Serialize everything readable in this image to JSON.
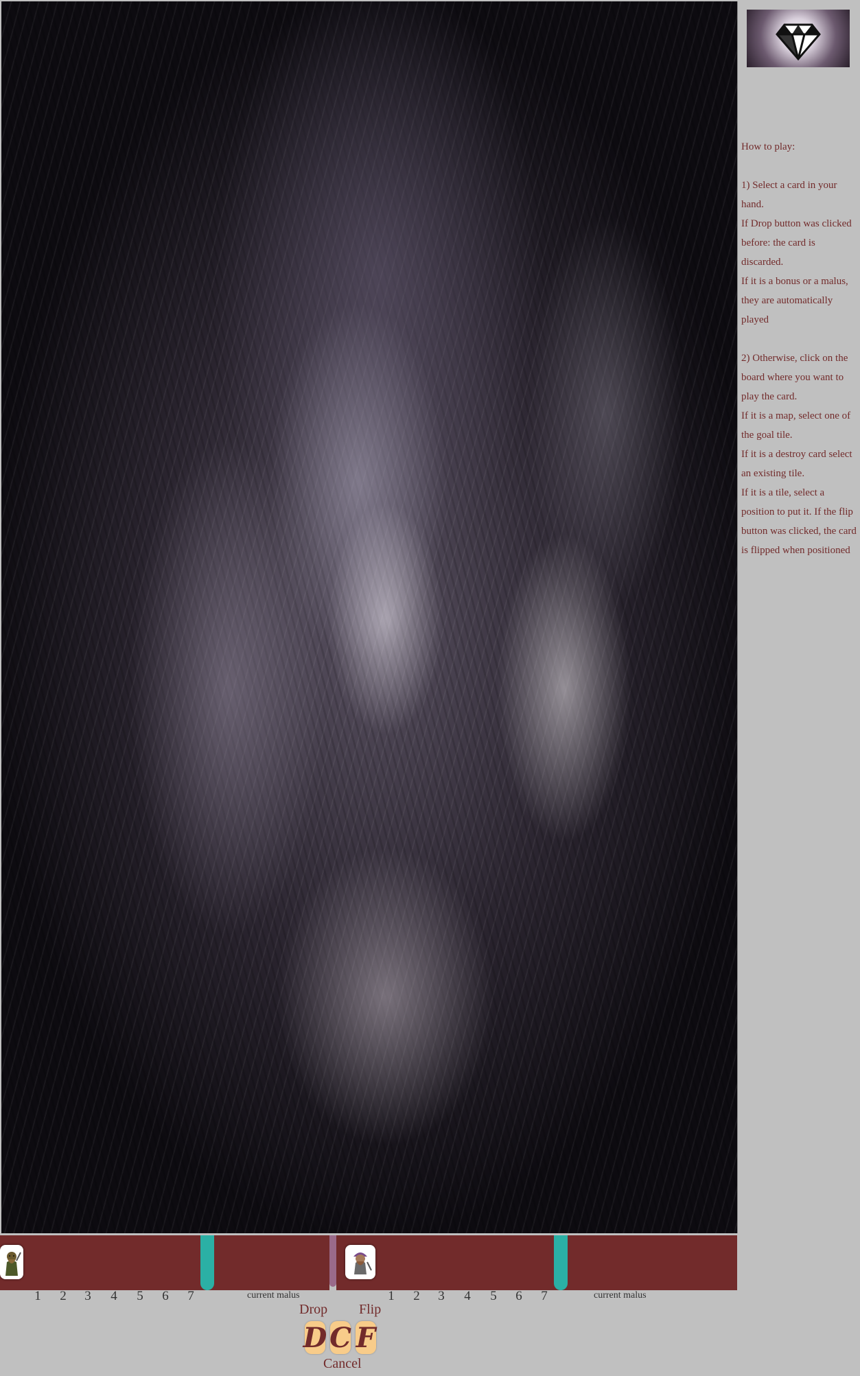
{
  "sidebar": {
    "logo_icon": "diamond-icon",
    "howto_title": "How to play:",
    "step1": [
      "1) Select a card in your hand.",
      "If Drop button was clicked before: the card is discarded.",
      "If it is a bonus or a malus, they are automatically played"
    ],
    "step2": [
      "2) Otherwise, click on the board where you want to play the card.",
      "If it is a map, select one of the goal tile.",
      "If it is a destroy card select an existing tile.",
      "If it is a tile, select a position to put it. If the flip button was clicked, the card is flipped when positioned"
    ]
  },
  "players": [
    {
      "avatar_icon": "dwarf-miner-icon",
      "positions": [
        "1",
        "2",
        "3",
        "4",
        "5",
        "6",
        "7"
      ],
      "malus_label": "current malus"
    },
    {
      "avatar_icon": "dwarf-warrior-icon",
      "positions": [
        "1",
        "2",
        "3",
        "4",
        "5",
        "6",
        "7"
      ],
      "malus_label": "current malus"
    }
  ],
  "controls": {
    "drop_label": "Drop",
    "flip_label": "Flip",
    "cancel_label": "Cancel",
    "drop_button": "D",
    "cancel_button": "C",
    "flip_button": "F"
  },
  "colors": {
    "strip": "#722b2b",
    "turn_marker": "#2bb0a5",
    "active_marker": "#9a6a8a",
    "button_face": "#f8cc8a",
    "text": "#722b2b",
    "background": "#c0c0c0"
  }
}
